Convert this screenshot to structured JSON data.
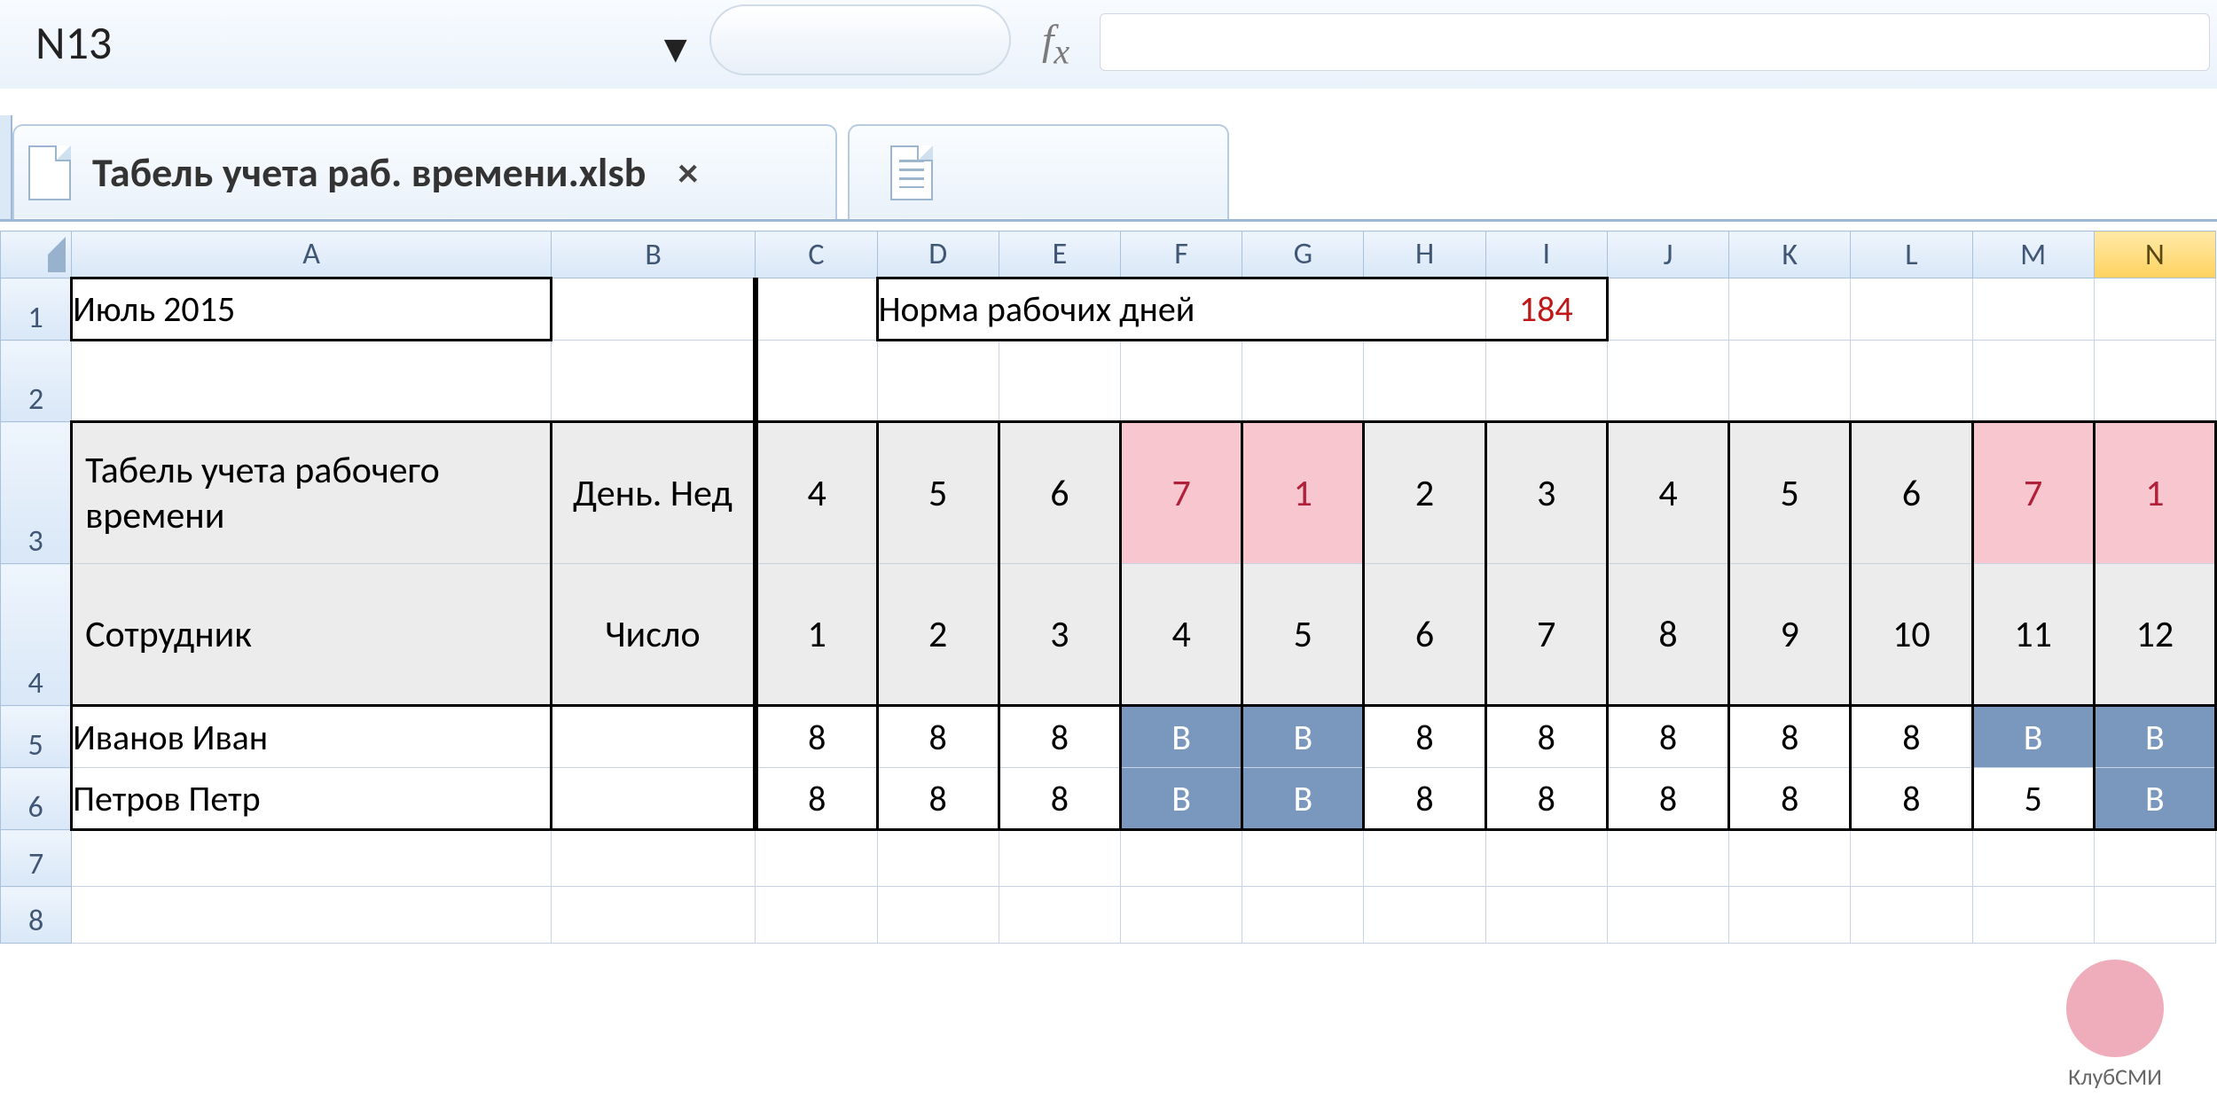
{
  "namebox": {
    "cell_ref": "N13"
  },
  "tabs": {
    "active_file": "Табель учета раб. времени.xlsb",
    "close_glyph": "×"
  },
  "columns": [
    "A",
    "B",
    "C",
    "D",
    "E",
    "F",
    "G",
    "H",
    "I",
    "J",
    "K",
    "L",
    "M",
    "N"
  ],
  "selected_column": "N",
  "row_headers": [
    "1",
    "2",
    "3",
    "4",
    "5",
    "6",
    "7",
    "8"
  ],
  "r1": {
    "month": "Июль 2015",
    "norm_label": "Норма рабочих дней",
    "norm_value": "184"
  },
  "r3": {
    "title": "Табель учета рабочего времени",
    "dow_label": "День. Нед",
    "dow": [
      "4",
      "5",
      "6",
      "7",
      "1",
      "2",
      "3",
      "4",
      "5",
      "6",
      "7",
      "1"
    ],
    "weekend_idx": [
      3,
      4,
      10,
      11
    ]
  },
  "r4": {
    "emp_label": "Сотрудник",
    "num_label": "Число",
    "nums": [
      "1",
      "2",
      "3",
      "4",
      "5",
      "6",
      "7",
      "8",
      "9",
      "10",
      "11",
      "12"
    ]
  },
  "employees": [
    {
      "name": "Иванов Иван",
      "cells": [
        "8",
        "8",
        "8",
        "В",
        "В",
        "8",
        "8",
        "8",
        "8",
        "8",
        "В",
        "В"
      ],
      "weekend_idx": [
        3,
        4,
        10,
        11
      ]
    },
    {
      "name": "Петров Петр",
      "cells": [
        "8",
        "8",
        "8",
        "В",
        "В",
        "8",
        "8",
        "8",
        "8",
        "8",
        "5",
        "В"
      ],
      "weekend_idx": [
        3,
        4,
        11
      ]
    }
  ],
  "watermark": "КлубСМИ"
}
